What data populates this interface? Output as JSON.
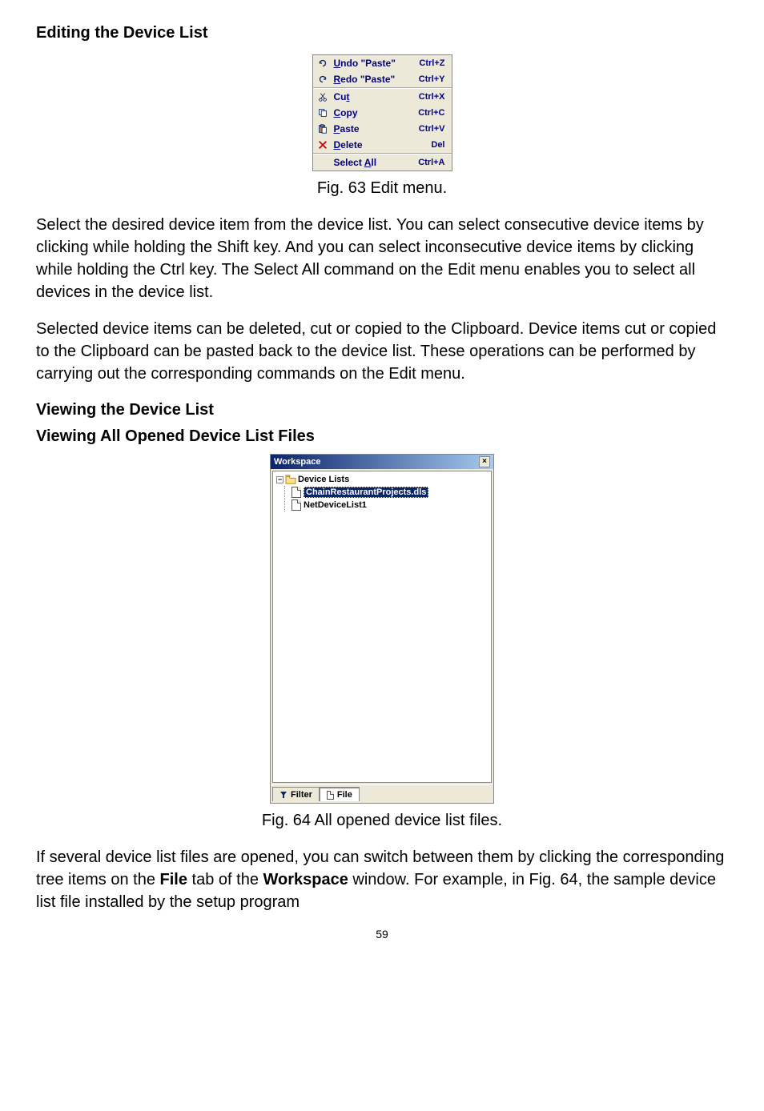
{
  "headings": {
    "editing": "Editing the Device List",
    "viewing": "Viewing the Device List",
    "viewing_all": "Viewing All Opened Device List Files"
  },
  "captions": {
    "fig63": "Fig. 63 Edit menu.",
    "fig64": "Fig. 64 All opened device list files."
  },
  "paragraphs": {
    "p1": "Select the desired device item from the device list. You can select consecutive device items by clicking while holding the Shift key. And you can select inconsecutive device items by clicking while holding the Ctrl key. The Select All command on the Edit menu enables you to select all devices in the device list.",
    "p2": "Selected device items can be deleted, cut or copied to the Clipboard. Device items cut or copied to the Clipboard can be pasted back to the device list. These operations can be performed by carrying out the corresponding commands on the Edit menu.",
    "p3_a": "If several device list files are opened, you can switch between them by clicking the corresponding tree items on the ",
    "p3_file": "File",
    "p3_b": " tab of the ",
    "p3_workspace": "Workspace",
    "p3_c": " window. For example, in Fig. 64, the sample device list file installed by the setup program"
  },
  "edit_menu": {
    "undo": {
      "label": "Undo \"Paste\"",
      "shortcut": "Ctrl+Z"
    },
    "redo": {
      "label": "Redo \"Paste\"",
      "shortcut": "Ctrl+Y"
    },
    "cut": {
      "label": "Cut",
      "shortcut": "Ctrl+X"
    },
    "copy": {
      "label": "Copy",
      "shortcut": "Ctrl+C"
    },
    "paste": {
      "label": "Paste",
      "shortcut": "Ctrl+V"
    },
    "delete": {
      "label": "Delete",
      "shortcut": "Del"
    },
    "select_all": {
      "label": "Select All",
      "shortcut": "Ctrl+A"
    }
  },
  "workspace": {
    "title": "Workspace",
    "close": "×",
    "root": "Device Lists",
    "items": [
      "ChainRestaurantProjects.dls",
      "NetDeviceList1"
    ],
    "tabs": {
      "filter": "Filter",
      "file": "File"
    }
  },
  "page_number": "59"
}
